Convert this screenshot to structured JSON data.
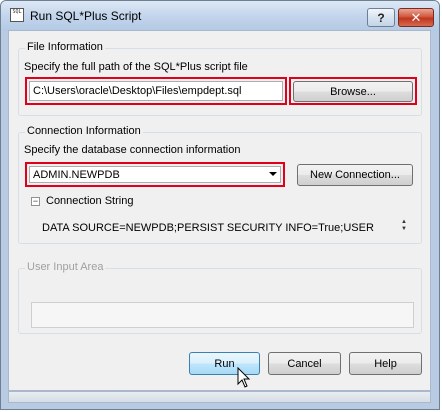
{
  "window": {
    "title": "Run SQL*Plus Script",
    "icon_text": "SQL",
    "help_label": "?",
    "close_label": "✕"
  },
  "file_info": {
    "group_title": "File Information",
    "instruction": "Specify the full path of the SQL*Plus script file",
    "path_value": "C:\\Users\\oracle\\Desktop\\Files\\empdept.sql",
    "browse_label": "Browse..."
  },
  "connection": {
    "group_title": "Connection Information",
    "instruction": "Specify the database connection information",
    "selected_connection": "ADMIN.NEWPDB",
    "new_connection_label": "New Connection...",
    "string_label": "Connection String",
    "expander_symbol": "−",
    "string_value": "DATA SOURCE=NEWPDB;PERSIST SECURITY INFO=True;USER"
  },
  "user_input": {
    "group_title": "User Input Area",
    "value": ""
  },
  "buttons": {
    "run": "Run",
    "cancel": "Cancel",
    "help": "Help"
  },
  "colors": {
    "highlight_box": "#e0001b"
  }
}
